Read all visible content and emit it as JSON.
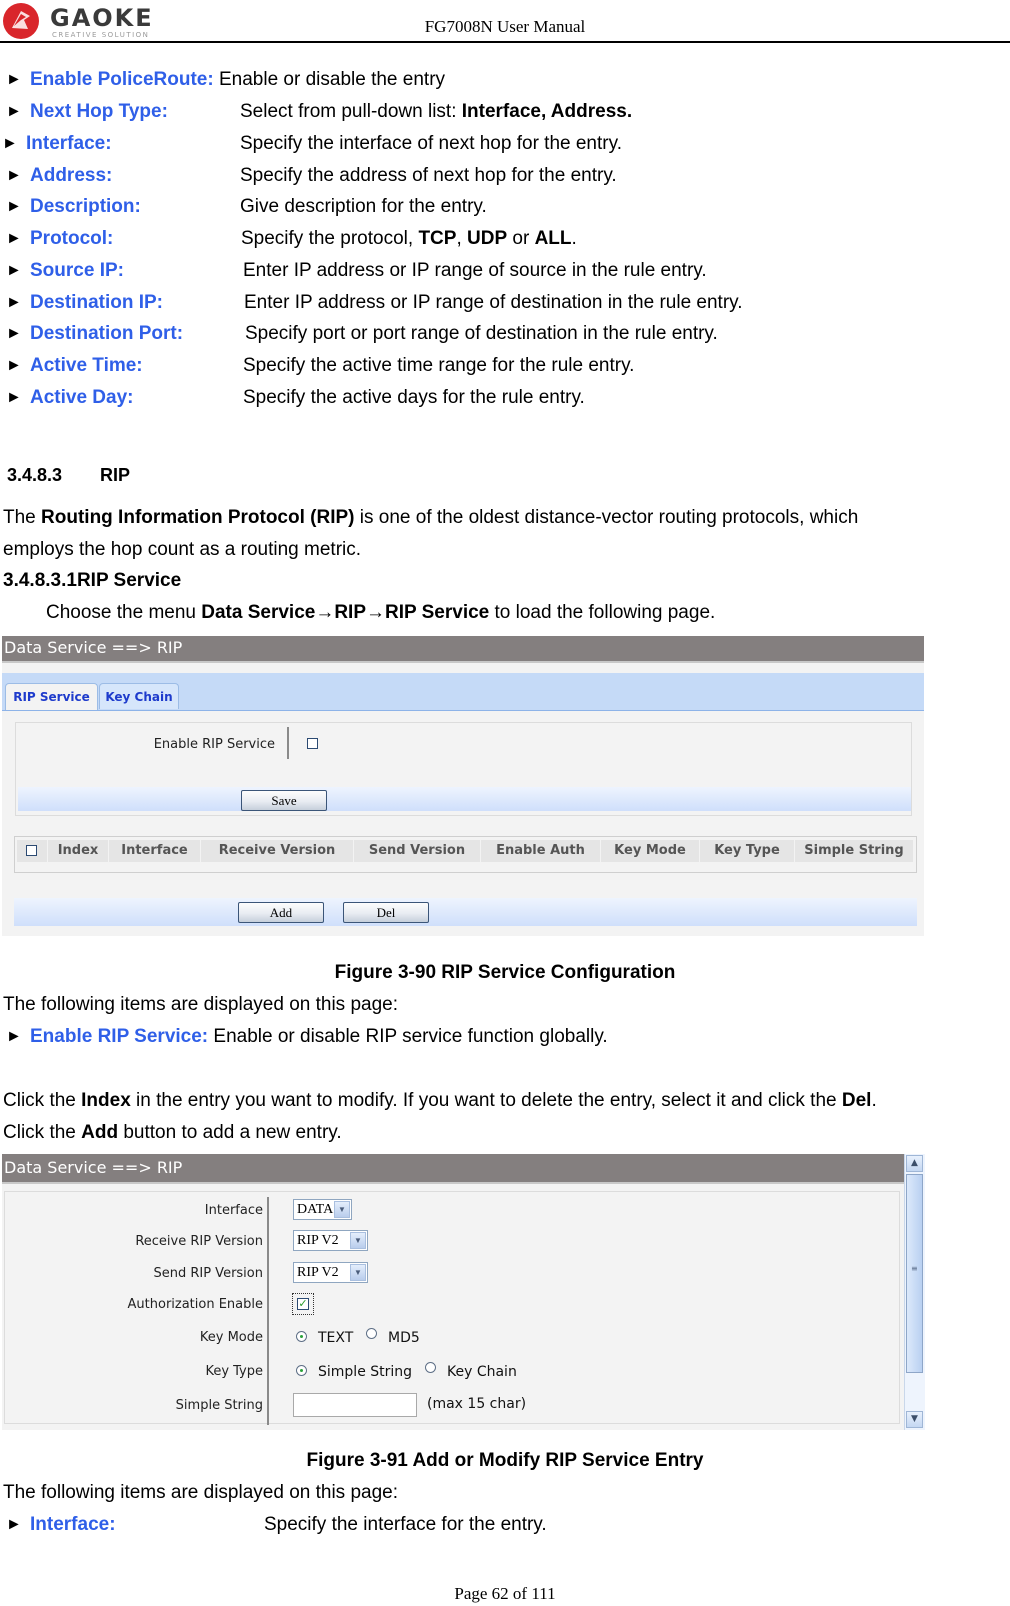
{
  "header": {
    "logo_text": "GAOKE",
    "logo_tagline": "CREATIVE SOLUTION",
    "title": "FG7008N User Manual"
  },
  "policy_route_items": [
    {
      "term": "Enable PoliceRoute:",
      "desc": "Enable or disable the entry"
    },
    {
      "term": "Next Hop Type:",
      "desc_pre": "Select from pull-down list: ",
      "desc_bold": "Interface, Address."
    },
    {
      "term": "Interface:",
      "desc": "Specify the interface of next hop for the entry."
    },
    {
      "term": "Address:",
      "desc": "Specify the address of next hop for the entry."
    },
    {
      "term": "Description:",
      "desc": "Give description for the entry."
    },
    {
      "term": "Protocol:",
      "desc_pre": "Specify the protocol, ",
      "b1": "TCP",
      "sep1": ", ",
      "b2": "UDP",
      "sep2": " or ",
      "b3": "ALL",
      "end": "."
    },
    {
      "term": "Source IP:",
      "desc": "Enter IP address or IP range of source in the rule entry."
    },
    {
      "term": "Destination IP:",
      "desc": "Enter IP address or IP range of destination in the rule entry."
    },
    {
      "term": "Destination Port:",
      "desc": "Specify port or port range of destination in the rule entry."
    },
    {
      "term": "Active Time:",
      "desc": "Specify the active time range for the rule entry."
    },
    {
      "term": "Active Day:",
      "desc": "Specify the active days for the rule entry."
    }
  ],
  "section": {
    "number": "3.4.8.3",
    "title": "RIP",
    "intro_pre": "The ",
    "intro_bold": "Routing Information Protocol (RIP)",
    "intro_post": " is one of the oldest distance-vector routing protocols, which",
    "intro_line2": "employs the hop count as a routing metric.",
    "sub_number": "3.4.8.3.1",
    "sub_title": "RIP Service",
    "menu_pre": "Choose the menu ",
    "menu_bold": "Data Service→RIP→RIP Service",
    "menu_post": " to load the following page."
  },
  "fig90": {
    "titlebar": "Data Service ==> RIP",
    "tabs": [
      {
        "label": "RIP Service",
        "active": true
      },
      {
        "label": "Key Chain",
        "active": false
      }
    ],
    "enable_label": "Enable RIP Service",
    "enable_checked": false,
    "save_label": "Save",
    "table_headers": [
      "Index",
      "Interface",
      "Receive Version",
      "Send Version",
      "Enable Auth",
      "Key Mode",
      "Key Type",
      "Simple String"
    ],
    "add_label": "Add",
    "del_label": "Del",
    "caption": "Figure 3-90  RIP Service Configuration"
  },
  "after90": {
    "items_intro": "The following items are displayed on this page:",
    "item_term": "Enable RIP Service:",
    "item_desc": " Enable or disable RIP service function globally.",
    "click1_a": "Click the ",
    "click1_b": "Index",
    "click1_c": " in the entry you want to modify. If you want to delete the entry, select it and click the ",
    "click1_d": "Del",
    "click1_e": ".",
    "click2_a": "Click the ",
    "click2_b": "Add",
    "click2_c": " button to add a new entry."
  },
  "fig91": {
    "titlebar": "Data Service ==> RIP",
    "fields": {
      "interface_label": "Interface",
      "interface_value": "DATA",
      "recv_label": "Receive RIP Version",
      "recv_value": "RIP V2",
      "send_label": "Send RIP Version",
      "send_value": "RIP V2",
      "auth_label": "Authorization Enable",
      "auth_checked": true,
      "keymode_label": "Key Mode",
      "keymode_options": [
        "TEXT",
        "MD5"
      ],
      "keymode_selected": "TEXT",
      "keytype_label": "Key Type",
      "keytype_options": [
        "Simple String",
        "Key Chain"
      ],
      "keytype_selected": "Simple String",
      "simple_label": "Simple String",
      "simple_value": "",
      "simple_hint": "(max 15 char)"
    },
    "caption": "Figure 3-91  Add or Modify RIP Service Entry"
  },
  "after91": {
    "items_intro": "The following items are displayed on this page:",
    "item_term": "Interface:",
    "item_desc": "Specify the interface for the entry."
  },
  "footer": {
    "page": "Page 62 of 111"
  },
  "colors": {
    "term_blue": "#2f5fe8",
    "titlebar_gray": "#847f7f",
    "tab_text": "#1e3bcc",
    "tabstrip": "#c5daf7"
  }
}
